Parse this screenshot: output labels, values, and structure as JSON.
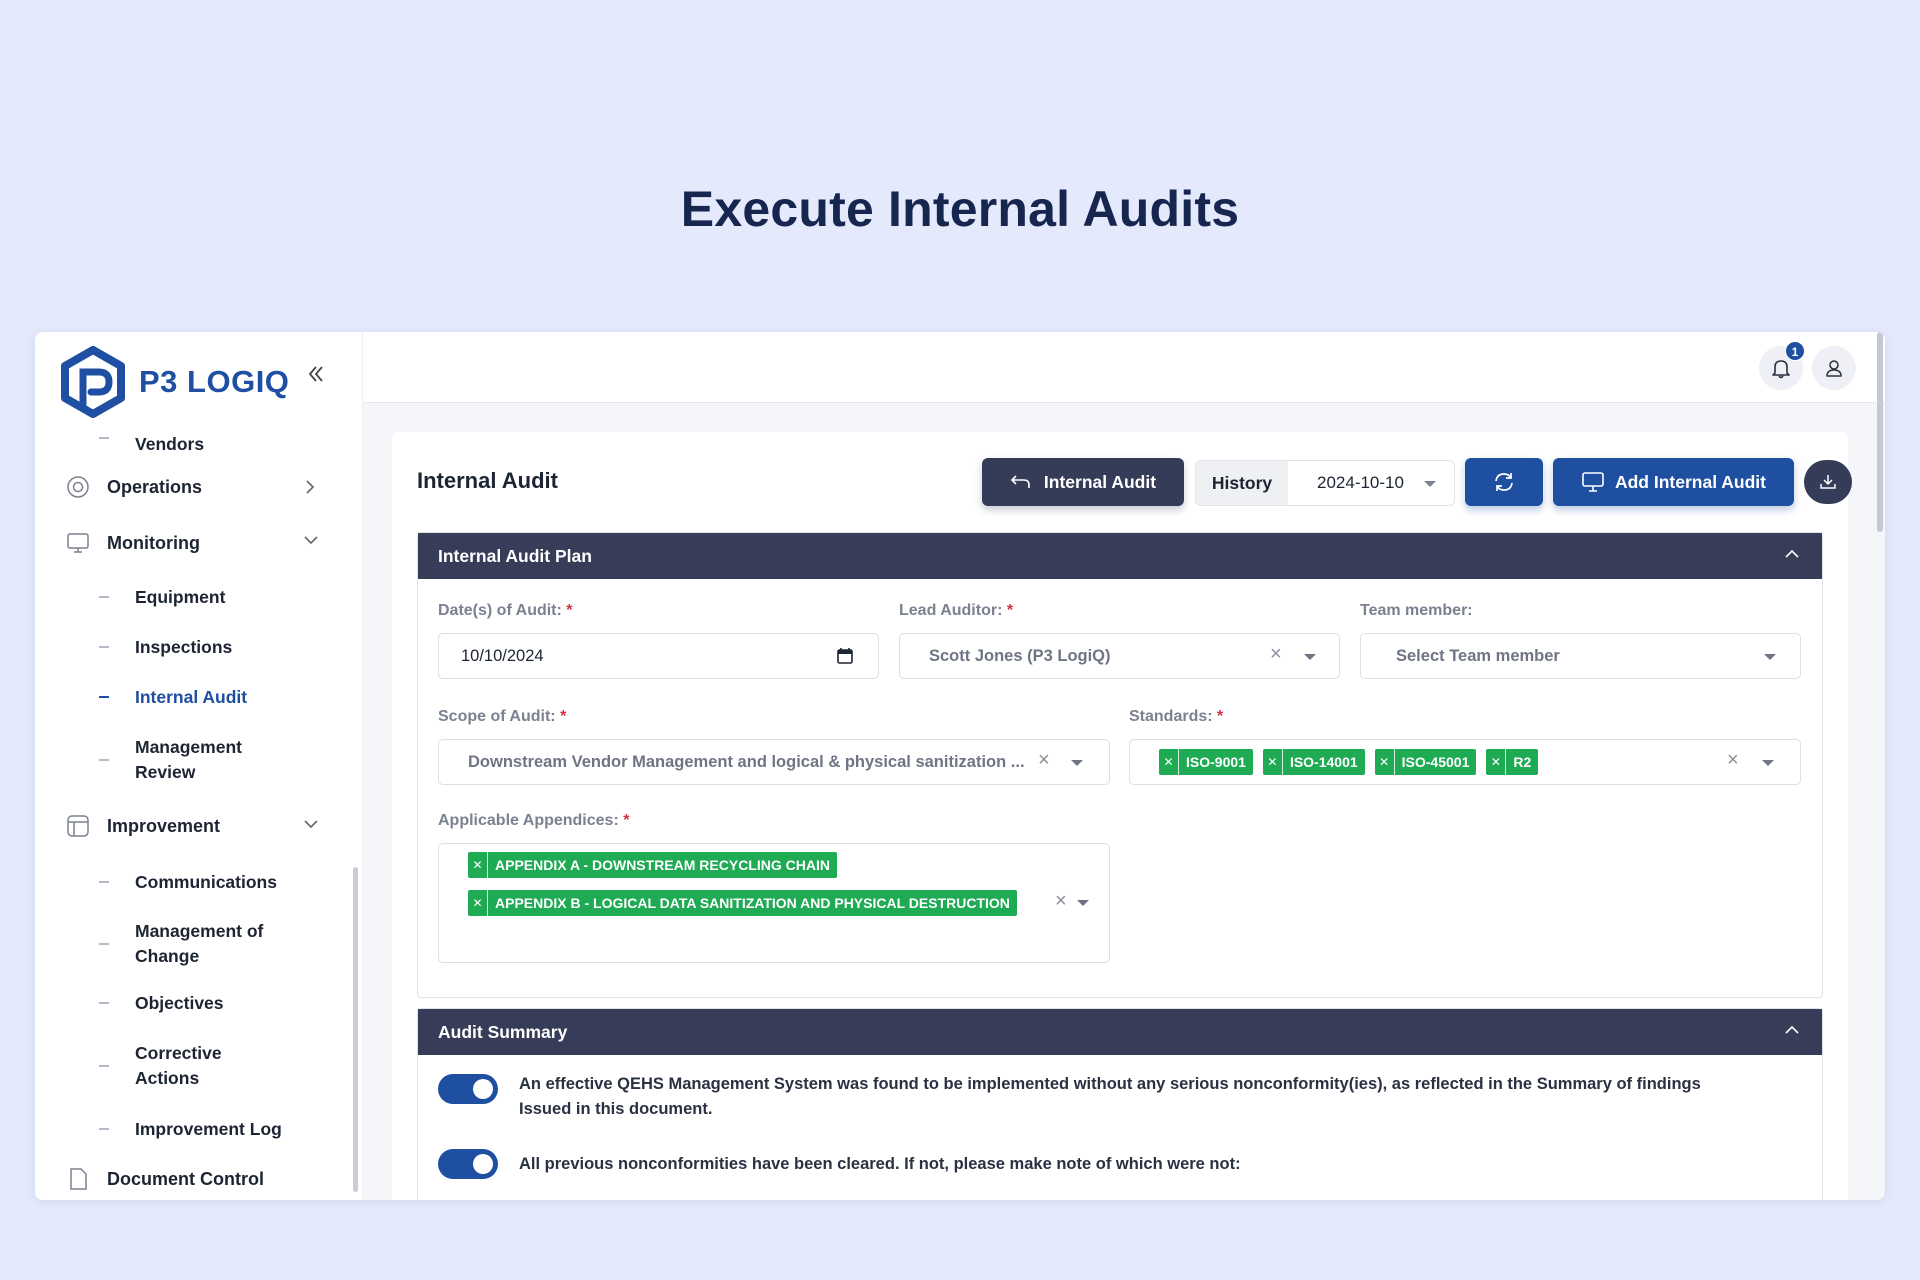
{
  "hero": {
    "title": "Execute Internal Audits"
  },
  "brand": {
    "name": "P3 LOGIQ"
  },
  "sidebar": {
    "vendors": "Vendors",
    "operations": "Operations",
    "monitoring": "Monitoring",
    "monitoring_items": [
      "Equipment",
      "Inspections",
      "Internal Audit",
      "Management\nReview"
    ],
    "improvement": "Improvement",
    "improvement_items": [
      "Communications",
      "Management of\nChange",
      "Objectives",
      "Corrective\nActions",
      "Improvement Log"
    ],
    "document_control": "Document Control"
  },
  "topbar": {
    "notification_count": "1"
  },
  "page": {
    "title": "Internal Audit",
    "back_button": "Internal Audit",
    "history_label": "History",
    "history_value": "2024-10-10",
    "add_button": "Add Internal Audit"
  },
  "plan": {
    "header": "Internal Audit Plan",
    "date_label": "Date(s) of Audit:",
    "date_value": "10/10/2024",
    "lead_label": "Lead Auditor:",
    "lead_value": "Scott Jones (P3 LogiQ)",
    "team_label": "Team member:",
    "team_placeholder": "Select Team member",
    "scope_label": "Scope of Audit:",
    "scope_value": "Downstream Vendor Management and logical & physical sanitization ...",
    "standards_label": "Standards:",
    "standards": [
      "ISO-9001",
      "ISO-14001",
      "ISO-45001",
      "R2"
    ],
    "appendices_label": "Applicable Appendices:",
    "appendices": [
      "APPENDIX A - DOWNSTREAM RECYCLING CHAIN",
      "APPENDIX B - LOGICAL DATA SANITIZATION AND PHYSICAL DESTRUCTION"
    ]
  },
  "summary": {
    "header": "Audit Summary",
    "items": [
      "An effective QEHS Management System was found to be implemented without any serious nonconformity(ies), as reflected in the Summary of findings Issued in this document.",
      "All previous nonconformities have been cleared. If not, please make note of which were not:"
    ],
    "toggles": [
      true,
      true
    ]
  },
  "colors": {
    "primary": "#1f4fa0",
    "dark": "#373d58",
    "tag": "#1faa54",
    "background": "#e4e9fc"
  }
}
